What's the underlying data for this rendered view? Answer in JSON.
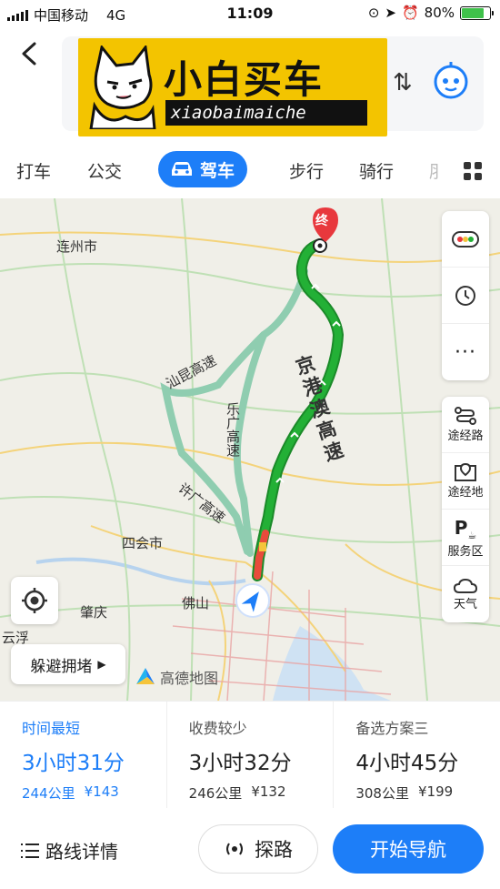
{
  "status_bar": {
    "carrier": "中国移动",
    "network": "4G",
    "time": "11:09",
    "battery": "80%",
    "battery_level": 0.8
  },
  "header": {
    "logo_title": "小白买车",
    "logo_subtitle": "xiaobaimaiche"
  },
  "tabs": [
    {
      "label": "打车"
    },
    {
      "label": "公交"
    },
    {
      "label": "驾车"
    },
    {
      "label": "步行"
    },
    {
      "label": "骑行"
    }
  ],
  "map": {
    "place_labels": [
      "连州市",
      "四会市",
      "肇庆",
      "佛山",
      "云浮"
    ],
    "road_labels": {
      "main": "京港澳高速",
      "alt1_a": "汕昆高速",
      "alt2": "乐广高速",
      "alt1_b": "许广高速"
    },
    "end_marker": "终",
    "side_panel_top": [
      "traffic-icon",
      "history-icon",
      "more-icon"
    ],
    "side_panel": [
      {
        "label": "途经路"
      },
      {
        "label": "途经地"
      },
      {
        "label": "服务区"
      },
      {
        "label": "天气"
      }
    ],
    "avoid_label": "躲避拥堵",
    "brand": "高德地图",
    "colors": {
      "route_main": "#23b036",
      "route_alt": "#8fcdb0",
      "congestion": "#e84b3c",
      "accent": "#1d7ef8"
    }
  },
  "plans": [
    {
      "label": "时间最短",
      "duration": "3小时31分",
      "distance": "244公里",
      "toll": "¥143"
    },
    {
      "label": "收费较少",
      "duration": "3小时32分",
      "distance": "246公里",
      "toll": "¥132"
    },
    {
      "label": "备选方案三",
      "duration": "4小时45分",
      "distance": "308公里",
      "toll": "¥199"
    }
  ],
  "bottom": {
    "detail_label": "路线详情",
    "probe_label": "探路",
    "start_label": "开始导航"
  }
}
